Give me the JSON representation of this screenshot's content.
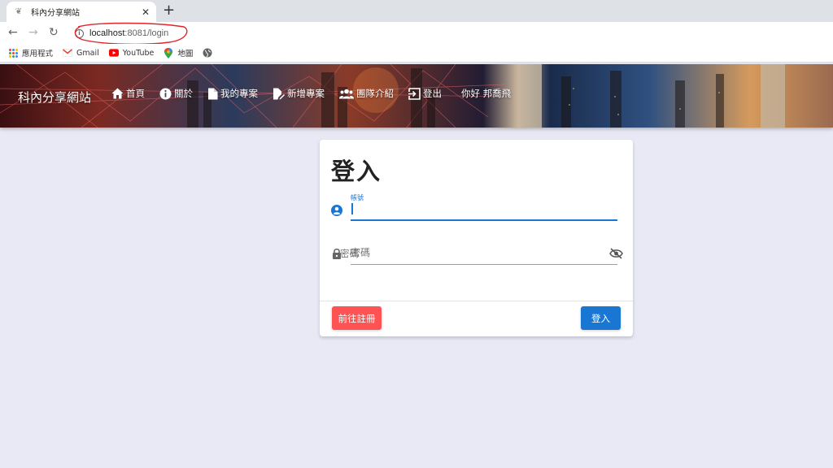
{
  "browser": {
    "tab_title": "科內分享網站",
    "url_host": "localhost",
    "url_rest": ":8081/login",
    "bookmarks": [
      {
        "label": "應用程式",
        "icon": "apps-grid-icon"
      },
      {
        "label": "Gmail",
        "icon": "gmail-icon"
      },
      {
        "label": "YouTube",
        "icon": "youtube-icon"
      },
      {
        "label": "地圖",
        "icon": "maps-icon"
      },
      {
        "label": "",
        "icon": "globe-icon"
      }
    ]
  },
  "header": {
    "brand": "科內分享網站",
    "nav": [
      {
        "label": "首頁",
        "icon": "home-icon"
      },
      {
        "label": "關於",
        "icon": "info-icon"
      },
      {
        "label": "我的專案",
        "icon": "file-icon"
      },
      {
        "label": "新增專案",
        "icon": "file-edit-icon"
      },
      {
        "label": "團隊介紹",
        "icon": "people-icon"
      },
      {
        "label": "登出",
        "icon": "logout-icon"
      }
    ],
    "greeting": "你好  邦喬飛"
  },
  "login": {
    "title": "登入",
    "username_label": "帳號",
    "username_value": "",
    "password_placeholder": "密碼",
    "register_button": "前往註冊",
    "login_button": "登入"
  },
  "colors": {
    "primary": "#1976d2",
    "register": "#ff5252",
    "page_bg": "#e8e9f4"
  }
}
